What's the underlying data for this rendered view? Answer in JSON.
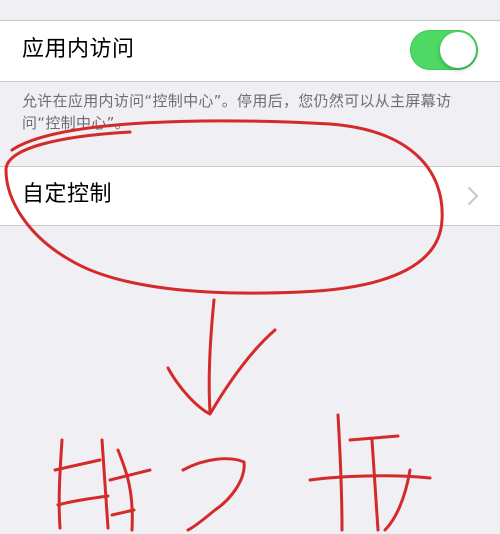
{
  "settings": {
    "access_within_apps": {
      "label": "应用内访问",
      "toggle_on": true
    },
    "footer_note": "允许在应用内访问“控制中心”。停用后，您仍然可以从主屏幕访问“控制中心”。",
    "customize_controls": {
      "label": "自定控制"
    }
  },
  "annotation": {
    "handwritten_text": "第2步",
    "color": "#d42a2a"
  },
  "colors": {
    "toggle_green": "#4cd964",
    "background": "#efeff4",
    "secondary_text": "#6d6d72"
  }
}
